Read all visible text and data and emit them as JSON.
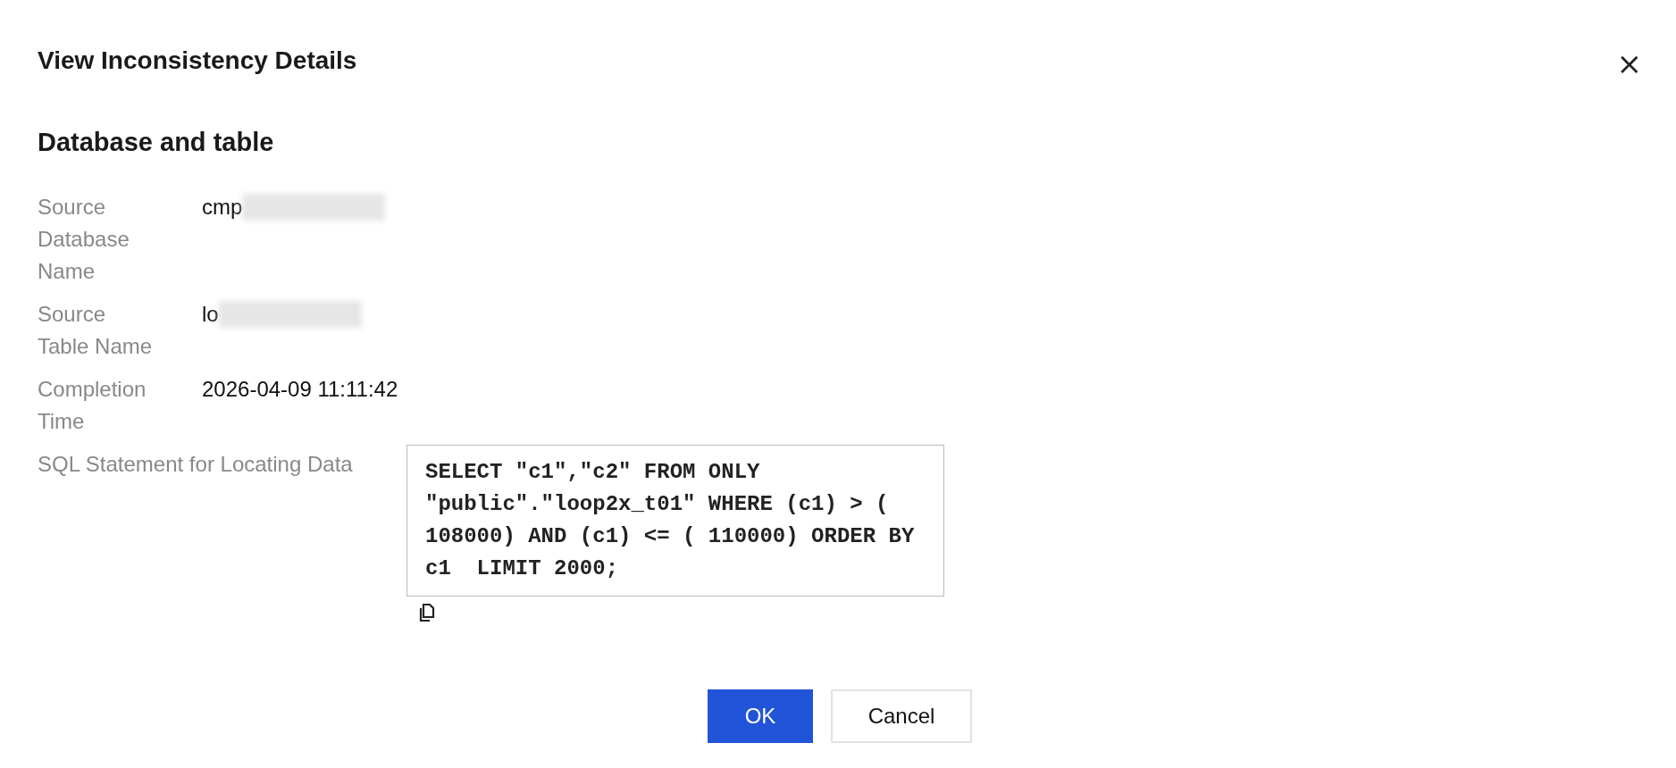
{
  "dialog": {
    "title": "View Inconsistency Details",
    "close_icon": "×"
  },
  "section": {
    "heading": "Database and table"
  },
  "fields": [
    {
      "kind": "text",
      "label": "Source Database Name",
      "value": "cmp",
      "blurred": true
    },
    {
      "kind": "text",
      "label": "Source Table Name",
      "value": "lo",
      "blurred": true
    },
    {
      "kind": "text",
      "label": "Completion Time",
      "value": "2026-04-09 11:11:42",
      "blurred": false
    },
    {
      "kind": "code",
      "label": "SQL Statement for Locating Data",
      "value": "SELECT \"c1\",\"c2\" FROM ONLY \"public\".\"loop2x_t01\" WHERE (c1) > ( 108000) AND (c1) <= ( 110000) ORDER BY c1  LIMIT 2000;",
      "blurred": false
    }
  ],
  "buttons": [
    {
      "label": "OK",
      "kind": "primary"
    },
    {
      "label": "Cancel",
      "kind": "secondary"
    }
  ]
}
